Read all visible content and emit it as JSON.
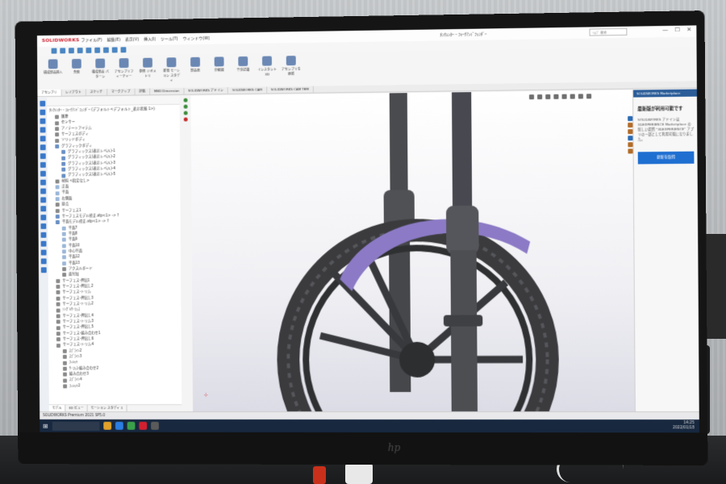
{
  "app": {
    "logo": "SOLIDWORKS",
    "menus": [
      "ファイル(F)",
      "編集(E)",
      "表示(V)",
      "挿入(I)",
      "ツール(T)",
      "ウィンドウ(W)"
    ],
    "document_title": "ﾀﾝｸﾚﾝﾀｰ・ﾌｫｰｸｱﾝﾄﾞﾌｪﾝﾀﾞｰ",
    "search_placeholder": "ﾍﾙﾌﾟ 検索",
    "window_controls": [
      "—",
      "☐",
      "✕"
    ]
  },
  "ribbon": {
    "buttons": [
      "構成部品挿入",
      "合致",
      "構成部品 パターン",
      "アセンブリフィーチャー",
      "参照 ジオメトリ",
      "新規 モーション スタディ",
      "部品表",
      "分解図",
      "干渉認識",
      "インスタント 3D",
      "アセンブリを 更新"
    ]
  },
  "tabs": {
    "items": [
      "アセンブリ",
      "レイアウト",
      "スケッチ",
      "マークアップ",
      "評価",
      "MBD Dimension",
      "SOLIDWORKS アドイン",
      "SOLIDWORKS CAM",
      "SOLIDWORKS CAM TBM"
    ],
    "active_index": 0
  },
  "tree": {
    "root": "ﾀﾝｸﾚﾝﾀｰ・ﾌｫｰｸｱﾝﾄﾞﾌｪﾝﾀﾞｰ (デフォルト<デフォルト_表示状態 1>)",
    "items": [
      {
        "label": "履歴",
        "level": 1,
        "kind": "feat"
      },
      {
        "label": "センサー",
        "level": 1,
        "kind": "feat"
      },
      {
        "label": "アノテートアイテム",
        "level": 1,
        "kind": "feat"
      },
      {
        "label": "サーフェスボディ",
        "level": 1,
        "kind": "feat"
      },
      {
        "label": "ソリッドボディ",
        "level": 1,
        "kind": "feat"
      },
      {
        "label": "グラフィックボディ",
        "level": 1,
        "kind": "asm"
      },
      {
        "label": "グラフィックス(表示レベル)-1",
        "level": 2,
        "kind": "asm"
      },
      {
        "label": "グラフィックス(表示レベル)-2",
        "level": 2,
        "kind": "asm"
      },
      {
        "label": "グラフィックス(表示レベル)-3",
        "level": 2,
        "kind": "asm"
      },
      {
        "label": "グラフィックス(表示レベル)-4",
        "level": 2,
        "kind": "asm"
      },
      {
        "label": "グラフィックス(表示レベル)-5",
        "level": 2,
        "kind": "asm"
      },
      {
        "label": "材料 <指定なし>",
        "level": 1,
        "kind": "feat"
      },
      {
        "label": "正面",
        "level": 1,
        "kind": "plane"
      },
      {
        "label": "平面",
        "level": 1,
        "kind": "plane"
      },
      {
        "label": "右側面",
        "level": 1,
        "kind": "plane"
      },
      {
        "label": "原点",
        "level": 1,
        "kind": "feat"
      },
      {
        "label": "サーフェス1",
        "level": 1,
        "kind": "feat"
      },
      {
        "label": "サーフェスモデル修正.stp<1> -> ?",
        "level": 1,
        "kind": "asm"
      },
      {
        "label": "平面モデル修正.stp<1> -> ?",
        "level": 1,
        "kind": "asm"
      },
      {
        "label": "平面7",
        "level": 2,
        "kind": "plane"
      },
      {
        "label": "平面8",
        "level": 2,
        "kind": "plane"
      },
      {
        "label": "平面9",
        "level": 2,
        "kind": "plane"
      },
      {
        "label": "平面10",
        "level": 2,
        "kind": "plane"
      },
      {
        "label": "中心平面",
        "level": 2,
        "kind": "plane"
      },
      {
        "label": "平面12",
        "level": 2,
        "kind": "plane"
      },
      {
        "label": "平面13",
        "level": 2,
        "kind": "plane"
      },
      {
        "label": "アクスルボード",
        "level": 2,
        "kind": "feat"
      },
      {
        "label": "面付加",
        "level": 2,
        "kind": "feat"
      },
      {
        "label": "サーフェス-押出1",
        "level": 1,
        "kind": "feat"
      },
      {
        "label": "サーフェス-押出し2",
        "level": 1,
        "kind": "feat"
      },
      {
        "label": "サーフェス-トリム",
        "level": 1,
        "kind": "feat"
      },
      {
        "label": "サーフェス-押出し3",
        "level": 1,
        "kind": "feat"
      },
      {
        "label": "サーフェス-トリム2",
        "level": 1,
        "kind": "feat"
      },
      {
        "label": "ｼﾝｸﾞﾙｻｰﾌｪｽ",
        "level": 1,
        "kind": "feat"
      },
      {
        "label": "サーフェス-押出し4",
        "level": 1,
        "kind": "feat"
      },
      {
        "label": "サーフェス-トリム3",
        "level": 1,
        "kind": "feat"
      },
      {
        "label": "サーフェス-押出し5",
        "level": 1,
        "kind": "feat"
      },
      {
        "label": "サーフェス-編み合わせ1",
        "level": 1,
        "kind": "feat"
      },
      {
        "label": "サーフェス-押出し6",
        "level": 1,
        "kind": "feat"
      },
      {
        "label": "サーフェス-トリム4",
        "level": 1,
        "kind": "feat"
      },
      {
        "label": "ｽﾌﾟﾗｲﾝ2",
        "level": 2,
        "kind": "feat"
      },
      {
        "label": "ｽﾌﾟﾗｲﾝ3",
        "level": 2,
        "kind": "feat"
      },
      {
        "label": "ﾌｨﾚｯﾄ",
        "level": 2,
        "kind": "feat"
      },
      {
        "label": "ｻｰﾌｪｽ-編み合わせ2",
        "level": 2,
        "kind": "feat"
      },
      {
        "label": "編み合わせ3",
        "level": 2,
        "kind": "feat"
      },
      {
        "label": "ｽﾌﾟﾗｲﾝ4",
        "level": 2,
        "kind": "feat"
      },
      {
        "label": "ﾌｨﾚｯﾄ2",
        "level": 2,
        "kind": "feat"
      }
    ],
    "bottom_tabs": [
      "モデル",
      "3D ビュー",
      "モーション スタディ 1"
    ]
  },
  "task_pane": {
    "header": "SOLIDWORKS Marketplace",
    "title": "最新版が利用可能です",
    "body": "SOLIDWORKS アドインは 3DEXPERIENCE Marketplace の新しい場所 \"3DEXPERIENCE\" アプリの一部として利用可能になりました。",
    "button": "更新を取得"
  },
  "status": {
    "text": "SOLIDWORKS Premium 2021 SP5.0"
  },
  "taskbar": {
    "clock_time": "14:25",
    "clock_date": "2022/01/18"
  },
  "colors": {
    "fender": "#8c7ac6",
    "tire": "#3d3d40",
    "accent": "#1f6fd1",
    "taskbar": "#17283f",
    "logo_red": "#d1202f"
  }
}
